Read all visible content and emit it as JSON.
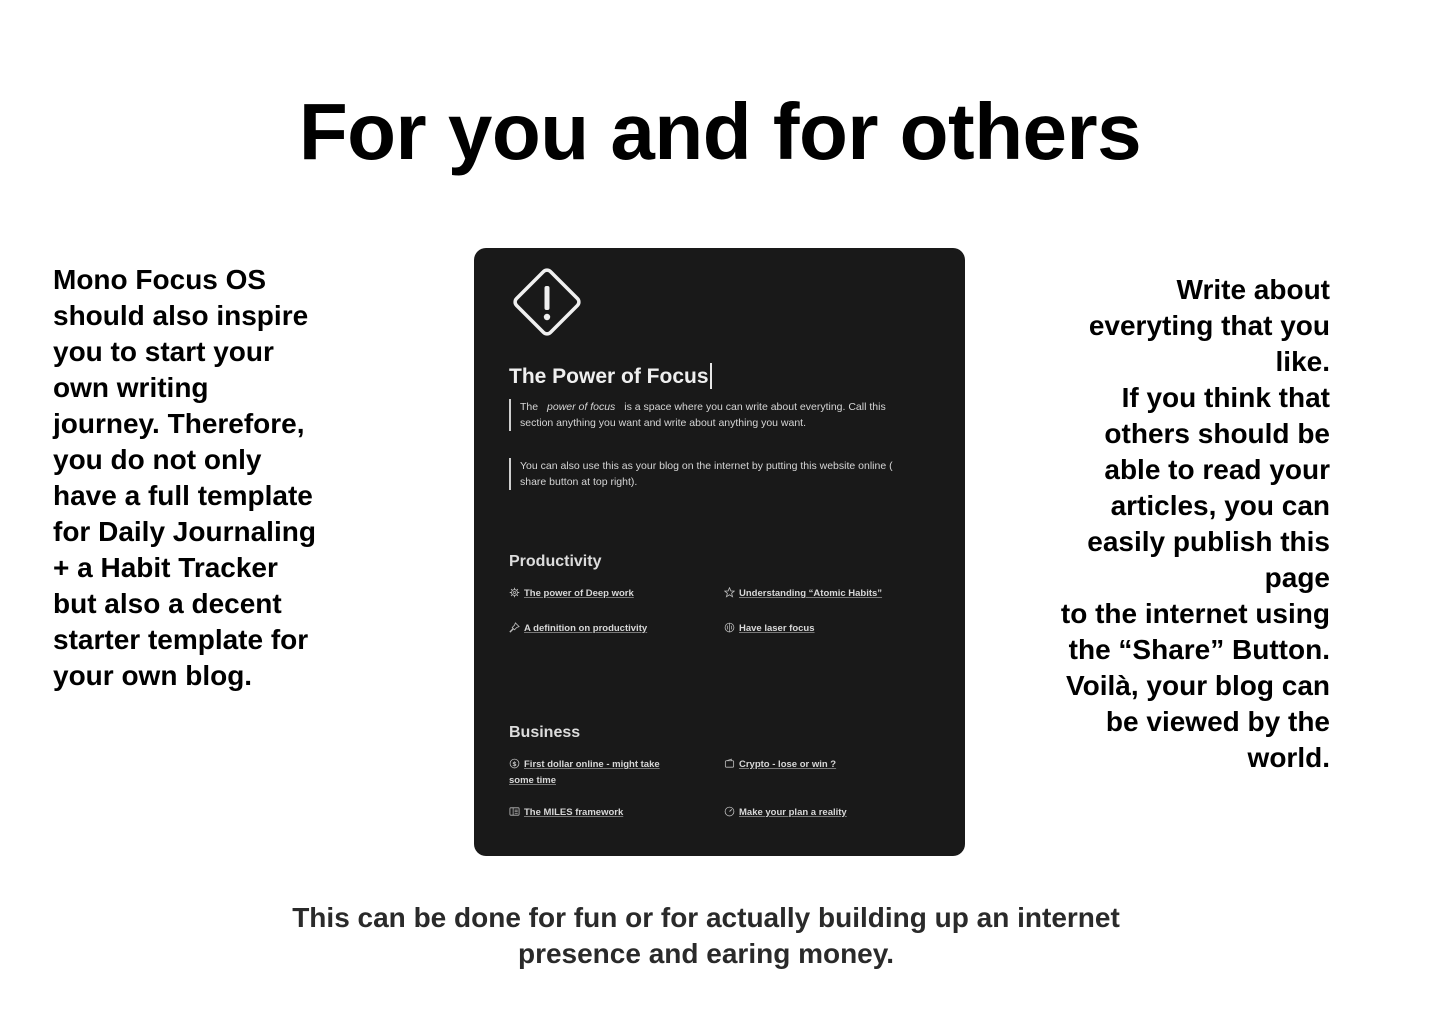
{
  "headline": "For you and for others",
  "left_paragraph": "Mono Focus OS should also inspire you to start your own writing journey. Therefore, you do not only have a full template for Daily Journaling + a Habit Tracker but also a decent starter template for your own blog.",
  "right_paragraph": {
    "line1": "Write about everyting that you like.",
    "line2": "If you think that others should be able to read your articles, you can easily publish this page",
    "line3": "to the internet using the “Share” Button. Voilà, your blog can be viewed by the world."
  },
  "bottom_paragraph": {
    "line1": "This can be done for fun or for actually building up an internet",
    "line2": "presence and earing money."
  },
  "preview": {
    "icon": "warning-diamond-icon",
    "title": "The Power of Focus",
    "quote1": {
      "before": "The",
      "emphasis": "power of focus",
      "after": "is a space where you can write about everyting. Call this section anything you want and write about anything you want."
    },
    "quote2": "You can also use this as your blog on the internet by putting this website online ( share button at top right).",
    "sections": [
      {
        "heading": "Productivity",
        "items": [
          {
            "label": "The power of Deep work",
            "icon": "gear-icon"
          },
          {
            "label": "Understanding “Atomic Habits”",
            "icon": "star-icon"
          },
          {
            "label": "A definition on productivity",
            "icon": "pin-icon"
          },
          {
            "label": "Have laser focus",
            "icon": "brain-icon"
          }
        ]
      },
      {
        "heading": "Business",
        "items": [
          {
            "label": "First dollar online - might take some time",
            "icon": "dollar-coin-icon"
          },
          {
            "label": "Crypto - lose or win ?",
            "icon": "wallet-icon"
          },
          {
            "label": "The MILES framework",
            "icon": "book-icon"
          },
          {
            "label": "Make your plan a reality",
            "icon": "gauge-icon"
          }
        ]
      }
    ]
  },
  "colors": {
    "background": "#ffffff",
    "text": "#000000",
    "card_background": "#191919",
    "card_text": "#e6e6e6"
  }
}
